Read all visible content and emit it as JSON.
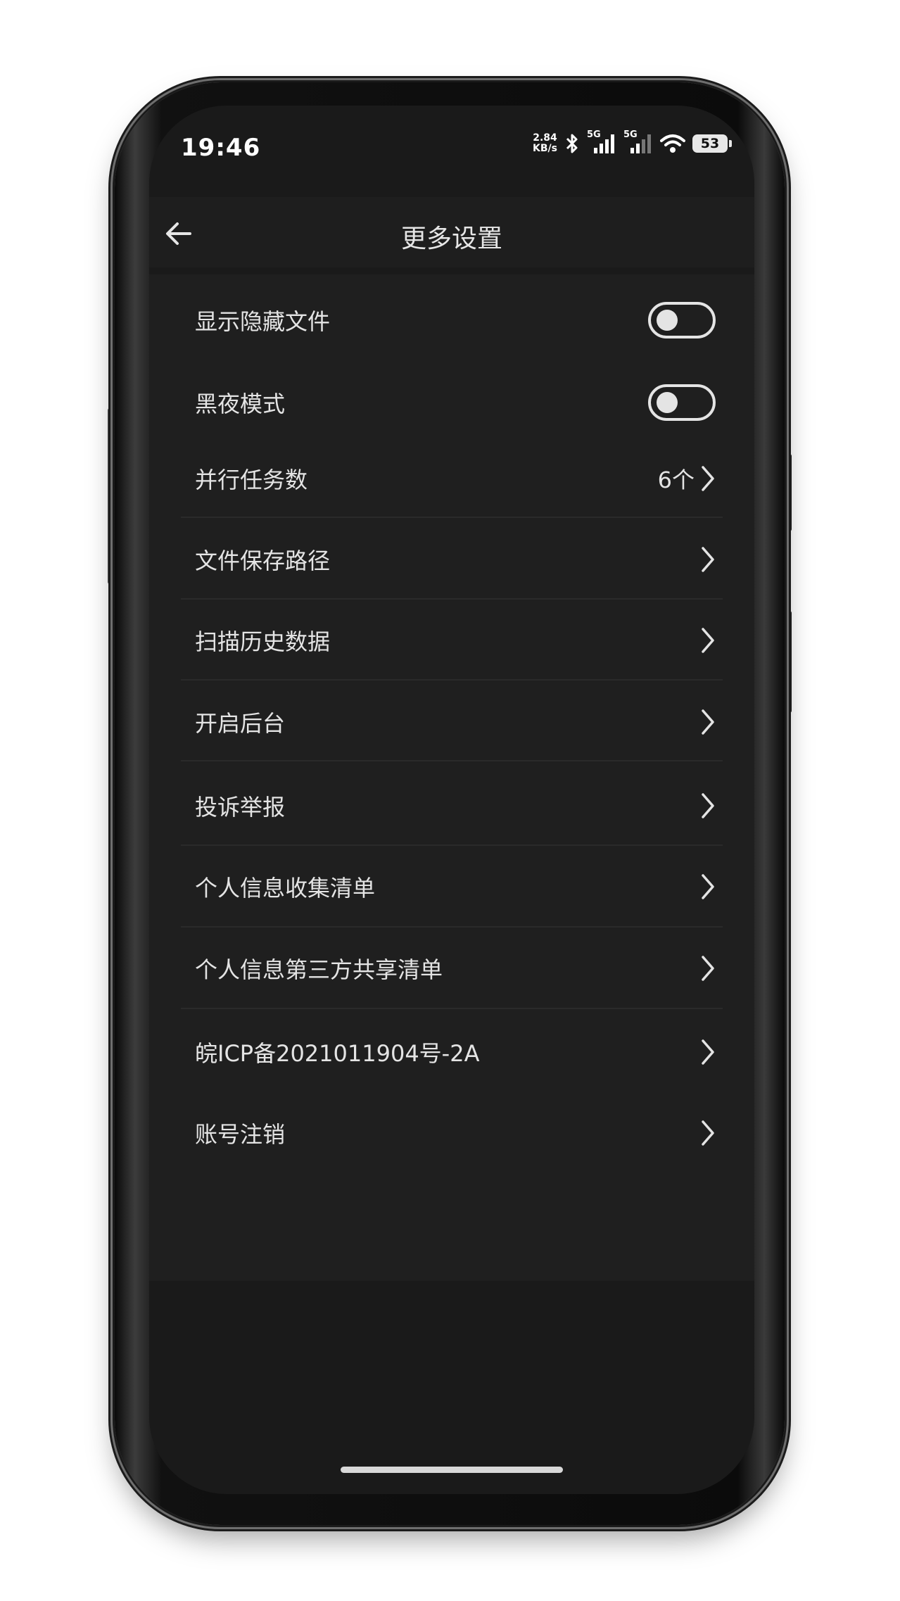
{
  "status_bar": {
    "time": "19:46",
    "net_speed_value": "2.84",
    "net_speed_unit": "KB/s",
    "signal_1_label": "5G",
    "signal_2_label": "5G",
    "battery_level": "53"
  },
  "header": {
    "title": "更多设置"
  },
  "settings": {
    "show_hidden_files": {
      "label": "显示隐藏文件",
      "enabled": false
    },
    "dark_mode": {
      "label": "黑夜模式",
      "enabled": false
    },
    "parallel_tasks": {
      "label": "并行任务数",
      "value": "6个"
    },
    "save_path": {
      "label": "文件保存路径"
    },
    "scan_history": {
      "label": "扫描历史数据"
    },
    "background": {
      "label": "开启后台"
    },
    "complaint": {
      "label": "投诉举报"
    },
    "personal_info_list": {
      "label": "个人信息收集清单"
    },
    "third_party_list": {
      "label": "个人信息第三方共享清单"
    },
    "icp": {
      "label": "皖ICP备2021011904号-2A"
    },
    "account_cancel": {
      "label": "账号注销"
    }
  },
  "colors": {
    "screen_bg": "#1a1a1a",
    "text": "#e4e4e4"
  }
}
